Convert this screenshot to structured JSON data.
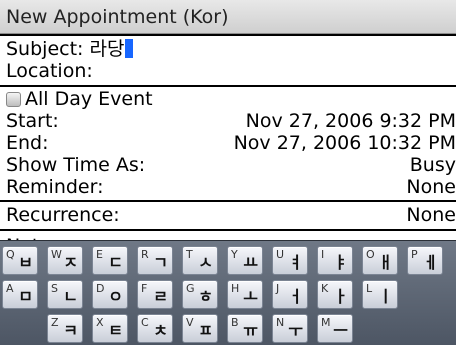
{
  "window": {
    "title": "New Appointment (Kor)"
  },
  "form": {
    "subject_label": "Subject:",
    "subject_value": "라당",
    "location_label": "Location:",
    "all_day_label": "All Day Event",
    "start_label": "Start:",
    "start_value": "Nov 27, 2006 9:32 PM",
    "end_label": "End:",
    "end_value": "Nov 27, 2006 10:32 PM",
    "show_time_label": "Show Time As:",
    "show_time_value": "Busy",
    "reminder_label": "Reminder:",
    "reminder_value": "None",
    "recurrence_label": "Recurrence:",
    "recurrence_value": "None",
    "notes_peek": "Notes:"
  },
  "keyboard": {
    "row1": [
      {
        "lat": "Q",
        "kor": "ㅂ"
      },
      {
        "lat": "W",
        "kor": "ㅈ"
      },
      {
        "lat": "E",
        "kor": "ㄷ"
      },
      {
        "lat": "R",
        "kor": "ㄱ"
      },
      {
        "lat": "T",
        "kor": "ㅅ"
      },
      {
        "lat": "Y",
        "kor": "ㅛ"
      },
      {
        "lat": "U",
        "kor": "ㅕ"
      },
      {
        "lat": "I",
        "kor": "ㅑ"
      },
      {
        "lat": "O",
        "kor": "ㅐ"
      },
      {
        "lat": "P",
        "kor": "ㅔ"
      }
    ],
    "row2": [
      {
        "lat": "A",
        "kor": "ㅁ"
      },
      {
        "lat": "S",
        "kor": "ㄴ"
      },
      {
        "lat": "D",
        "kor": "ㅇ"
      },
      {
        "lat": "F",
        "kor": "ㄹ"
      },
      {
        "lat": "G",
        "kor": "ㅎ"
      },
      {
        "lat": "H",
        "kor": "ㅗ"
      },
      {
        "lat": "J",
        "kor": "ㅓ"
      },
      {
        "lat": "K",
        "kor": "ㅏ"
      },
      {
        "lat": "L",
        "kor": "ㅣ"
      }
    ],
    "row3": [
      {
        "lat": "Z",
        "kor": "ㅋ"
      },
      {
        "lat": "X",
        "kor": "ㅌ"
      },
      {
        "lat": "C",
        "kor": "ㅊ"
      },
      {
        "lat": "V",
        "kor": "ㅍ"
      },
      {
        "lat": "B",
        "kor": "ㅠ"
      },
      {
        "lat": "N",
        "kor": "ㅜ"
      },
      {
        "lat": "M",
        "kor": "ㅡ"
      }
    ]
  }
}
